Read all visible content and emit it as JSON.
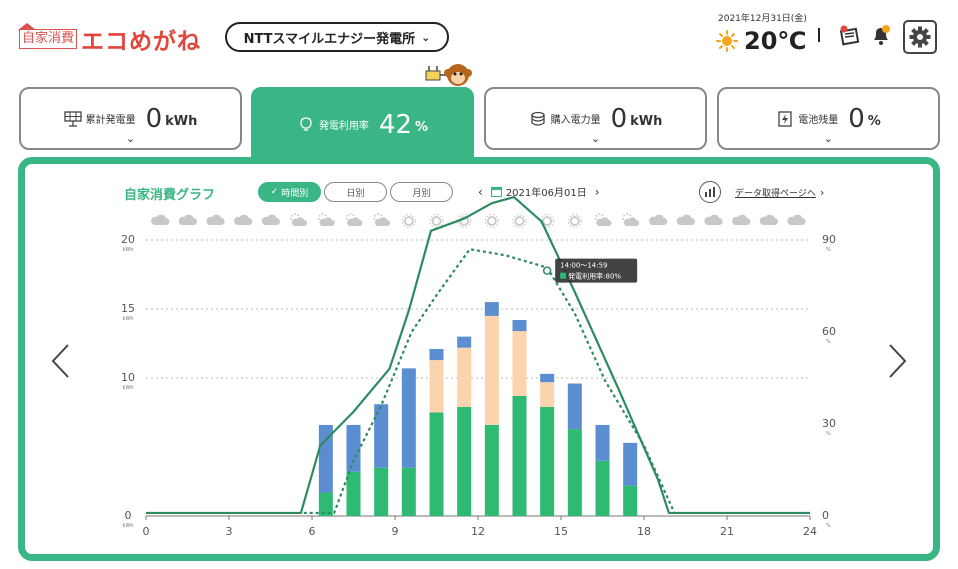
{
  "header": {
    "logo_box_text": "自家消費",
    "logo_text": "エコめがね",
    "plant_name": "NTTスマイルエナジー発電所",
    "date": "2021年12月31日(金)",
    "temperature": "20℃"
  },
  "cards": [
    {
      "label": "累計発電量",
      "value": "0",
      "unit": "kWh",
      "icon": "solar-panel-icon",
      "active": false
    },
    {
      "label": "発電利用率",
      "value": "42",
      "unit": "%",
      "icon": "lightbulb-icon",
      "active": true
    },
    {
      "label": "購入電力量",
      "value": "0",
      "unit": "kWh",
      "icon": "coin-stack-icon",
      "active": false
    },
    {
      "label": "電池残量",
      "value": "0",
      "unit": "%",
      "icon": "battery-icon",
      "active": false
    }
  ],
  "graph": {
    "title": "自家消費グラフ",
    "tabs": [
      {
        "label": "時間別",
        "active": true
      },
      {
        "label": "日別",
        "active": false
      },
      {
        "label": "月別",
        "active": false
      }
    ],
    "date": "2021年06月01日",
    "data_link": "データ取得ページへ",
    "tooltip_time": "14:00～14:59",
    "tooltip_value": "発電利用率:80%"
  },
  "colors": {
    "accent": "#3ab585",
    "bar_green": "#2fba74",
    "bar_peach": "#fbd3ad",
    "bar_blue": "#5b8ed0",
    "line_dark": "#2e8a5f"
  },
  "chart_data": {
    "type": "bar",
    "x_ticks": [
      "0",
      "3",
      "6",
      "9",
      "12",
      "15",
      "18",
      "21",
      "24"
    ],
    "y_left_ticks": [
      "0",
      "10",
      "15",
      "20"
    ],
    "y_left_unit": "kWh",
    "y_right_ticks": [
      "0",
      "30",
      "60",
      "90"
    ],
    "y_right_unit": "%",
    "xlim": [
      0,
      24
    ],
    "ylim_left": [
      0,
      20
    ],
    "ylim_right": [
      0,
      90
    ],
    "weather": [
      "cloud",
      "cloud",
      "cloud",
      "cloud",
      "cloud",
      "sun-cloud",
      "sun-cloud",
      "sun-cloud",
      "sun-cloud",
      "sun",
      "sun",
      "sun",
      "sun",
      "sun",
      "sun",
      "sun",
      "sun-cloud",
      "sun-cloud",
      "cloud",
      "cloud",
      "cloud",
      "cloud",
      "cloud",
      "cloud"
    ],
    "bars": [
      {
        "hour": 6,
        "green": 1.7,
        "peach": 0,
        "blue": 4.9
      },
      {
        "hour": 7,
        "green": 3.2,
        "peach": 0,
        "blue": 3.4
      },
      {
        "hour": 8,
        "green": 3.5,
        "peach": 0,
        "blue": 4.6
      },
      {
        "hour": 9,
        "green": 3.5,
        "peach": 0,
        "blue": 7.2
      },
      {
        "hour": 10,
        "green": 7.5,
        "peach": 3.8,
        "blue": 0.8
      },
      {
        "hour": 11,
        "green": 7.9,
        "peach": 4.3,
        "blue": 0.8
      },
      {
        "hour": 12,
        "green": 6.6,
        "peach": 7.9,
        "blue": 1.0
      },
      {
        "hour": 13,
        "green": 8.7,
        "peach": 4.7,
        "blue": 0.8
      },
      {
        "hour": 14,
        "green": 7.9,
        "peach": 1.8,
        "blue": 0.6
      },
      {
        "hour": 15,
        "green": 6.3,
        "peach": 0,
        "blue": 3.3
      },
      {
        "hour": 16,
        "green": 4.0,
        "peach": 0,
        "blue": 2.6
      },
      {
        "hour": 17,
        "green": 2.2,
        "peach": 0,
        "blue": 3.1
      }
    ],
    "line_solid_pct": [
      [
        0,
        1
      ],
      [
        5.6,
        1
      ],
      [
        6.3,
        23
      ],
      [
        7.5,
        34
      ],
      [
        8.8,
        48
      ],
      [
        9.5,
        67
      ],
      [
        10.3,
        93
      ],
      [
        11.5,
        97
      ],
      [
        12.5,
        102
      ],
      [
        13.3,
        104
      ],
      [
        14.3,
        96
      ],
      [
        15.5,
        73
      ],
      [
        17.1,
        41
      ],
      [
        18.5,
        12
      ],
      [
        18.9,
        1
      ],
      [
        24,
        1
      ]
    ],
    "line_dotted_pct": [
      [
        5.7,
        1
      ],
      [
        6.8,
        1
      ],
      [
        7.5,
        18
      ],
      [
        8.5,
        36
      ],
      [
        9.6,
        60
      ],
      [
        10.5,
        72
      ],
      [
        11.7,
        87
      ],
      [
        13,
        85
      ],
      [
        14.5,
        81
      ],
      [
        15.5,
        66
      ],
      [
        16.6,
        44
      ],
      [
        18,
        23
      ],
      [
        19.1,
        1
      ]
    ]
  }
}
